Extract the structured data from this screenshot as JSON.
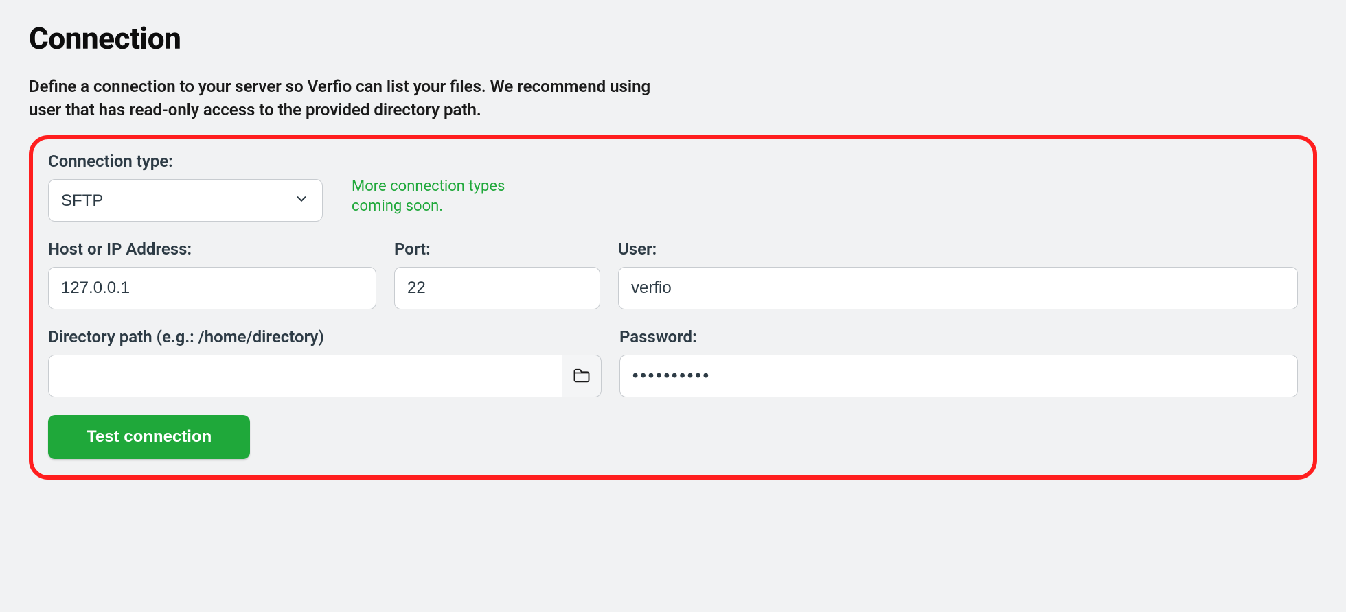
{
  "heading": "Connection",
  "description": "Define a connection to your server so Verfio can list your files. We recommend using user that has read-only access to the provided directory path.",
  "form": {
    "connection_type": {
      "label": "Connection type:",
      "selected": "SFTP",
      "hint": "More connection types coming soon."
    },
    "host": {
      "label": "Host or IP Address:",
      "value": "127.0.0.1"
    },
    "port": {
      "label": "Port:",
      "value": "22"
    },
    "user": {
      "label": "User:",
      "value": "verfio"
    },
    "directory": {
      "label": "Directory path (e.g.: /home/directory)",
      "value": ""
    },
    "password": {
      "label": "Password:",
      "value": "••••••••••"
    },
    "test_button": "Test connection"
  }
}
